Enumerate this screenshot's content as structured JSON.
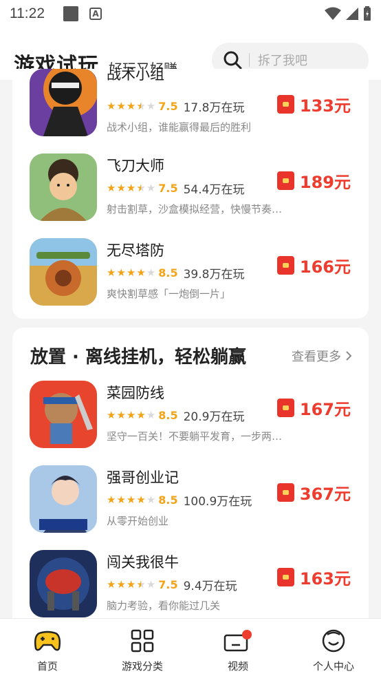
{
  "status": {
    "time": "11:22"
  },
  "header": {
    "title": "游戏试玩",
    "subtitle": "好玩又好赚",
    "search_placeholder": "拆了我吧"
  },
  "games_top": [
    {
      "name": "战术小组",
      "rating": "7.5",
      "stars": 3.5,
      "players": "17.8万在玩",
      "desc": "战术小组，谁能赢得最后的胜利",
      "reward": "133元"
    },
    {
      "name": "飞刀大师",
      "rating": "7.5",
      "stars": 3.5,
      "players": "54.4万在玩",
      "desc": "射击割草，沙盒模拟经营，快慢节奏…",
      "reward": "189元"
    },
    {
      "name": "无尽塔防",
      "rating": "8.5",
      "stars": 4,
      "players": "39.8万在玩",
      "desc": "爽快割草感「一炮倒一片」",
      "reward": "166元"
    }
  ],
  "section2": {
    "title": "放置 · 离线挂机，轻松躺赢",
    "more": "查看更多"
  },
  "games_bottom": [
    {
      "name": "菜园防线",
      "rating": "8.5",
      "stars": 4,
      "players": "20.9万在玩",
      "desc": "坚守一百关！不要躺平发育，一步两…",
      "reward": "167元"
    },
    {
      "name": "强哥创业记",
      "rating": "8.5",
      "stars": 4,
      "players": "100.9万在玩",
      "desc": "从零开始创业",
      "reward": "367元"
    },
    {
      "name": "闯关我很牛",
      "rating": "7.5",
      "stars": 3.5,
      "players": "9.4万在玩",
      "desc": "脑力考验，看你能过几关",
      "reward": "163元"
    }
  ],
  "tabs": [
    {
      "label": "首页",
      "icon": "gamepad-icon",
      "active": true
    },
    {
      "label": "游戏分类",
      "icon": "grid-icon",
      "active": false
    },
    {
      "label": "视频",
      "icon": "video-icon",
      "active": false
    },
    {
      "label": "个人中心",
      "icon": "smiley-icon",
      "active": false
    }
  ],
  "colors": {
    "accent": "#ee3c2e",
    "star": "#f3a316",
    "tab_active_icon": "#f7c21b"
  }
}
